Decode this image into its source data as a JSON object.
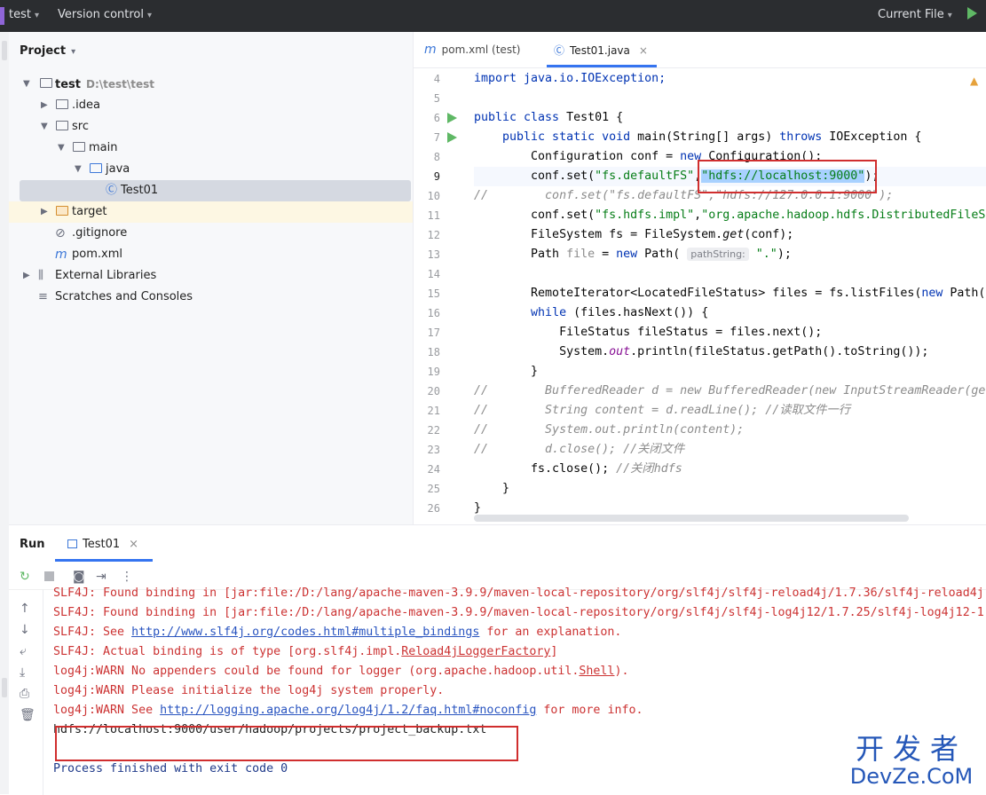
{
  "titlebar": {
    "project": "test",
    "vcs": "Version control",
    "run_config": "Current File"
  },
  "project_panel": {
    "title": "Project",
    "tree": [
      {
        "label": "test",
        "path": "D:\\test\\test"
      },
      {
        "label": ".idea"
      },
      {
        "label": "src"
      },
      {
        "label": "main"
      },
      {
        "label": "java"
      },
      {
        "label": "Test01"
      },
      {
        "label": "target"
      },
      {
        "label": ".gitignore"
      },
      {
        "label": "pom.xml"
      },
      {
        "label": "External Libraries"
      },
      {
        "label": "Scratches and Consoles"
      }
    ]
  },
  "editor": {
    "tabs": [
      {
        "label": "pom.xml (test)"
      },
      {
        "label": "Test01.java"
      }
    ],
    "line_numbers": [
      "4",
      "5",
      "6",
      "7",
      "8",
      "9",
      "10",
      "11",
      "12",
      "13",
      "14",
      "15",
      "16",
      "17",
      "18",
      "19",
      "20",
      "21",
      "22",
      "23",
      "24",
      "25",
      "26"
    ],
    "code": {
      "l4": "import java.io.IOException;",
      "l6a": "public class ",
      "l6b": "Test01 {",
      "l7a": "    public static void ",
      "l7b": "main(String[] args) ",
      "l7c": "throws ",
      "l7d": "IOException {",
      "l8a": "        Configuration conf = ",
      "l8b": "new ",
      "l8c": "Configuration();",
      "l9a": "        conf.set(",
      "l9b": "\"fs.defaultFS\"",
      "l9c": ",",
      "l9d": "\"hdfs://localhost:9000\"",
      "l9e": ");",
      "l10": "//        conf.set(\"fs.defaultFS\",\"hdfs://127.0.0.1:9000\");",
      "l11a": "        conf.set(",
      "l11b": "\"fs.hdfs.impl\"",
      "l11c": ",",
      "l11d": "\"org.apache.hadoop.hdfs.DistributedFileS",
      "l12a": "        FileSystem fs = FileSystem.",
      "l12b": "get",
      "l12c": "(conf);",
      "l13a": "        Path ",
      "l13b": "file",
      "l13c": " = ",
      "l13d": "new ",
      "l13e": "Path( ",
      "l13hint": "pathString:",
      "l13f": " ",
      "l13g": "\".\"",
      "l13h": ");",
      "l15a": "        RemoteIterator<LocatedFileStatus> files = fs.listFiles(",
      "l15b": "new ",
      "l15c": "Path(",
      "l16a": "        ",
      "l16b": "while ",
      "l16c": "(files.hasNext()) {",
      "l17": "            FileStatus fileStatus = files.next();",
      "l18a": "            System.",
      "l18b": "out",
      "l18c": ".println(fileStatus.getPath().toString());",
      "l19": "        }",
      "l20": "//        BufferedReader d = new BufferedReader(new InputStreamReader(ge",
      "l21": "//        String content = d.readLine(); //读取文件一行",
      "l22": "//        System.out.println(content);",
      "l23": "//        d.close(); //关闭文件",
      "l24a": "        fs.close(); ",
      "l24b": "//关闭hdfs",
      "l25": "    }",
      "l26": "}"
    }
  },
  "run_panel": {
    "title": "Run",
    "tab": "Test01",
    "output": {
      "o1": "SLF4J: Found binding in [jar:file:/D:/lang/apache-maven-3.9.9/maven-local-repository/org/slf4j/slf4j-reload4j/1.7.36/slf4j-reload4j-",
      "o2": "SLF4J: Found binding in [jar:file:/D:/lang/apache-maven-3.9.9/maven-local-repository/org/slf4j/slf4j-log4j12/1.7.25/slf4j-log4j12-1",
      "o3a": "SLF4J: See ",
      "o3b": "http://www.slf4j.org/codes.html#multiple_bindings",
      "o3c": " for an explanation.",
      "o4a": "SLF4J: Actual binding is of type [org.slf4j.impl.",
      "o4b": "Reload4jLoggerFactory",
      "o4c": "]",
      "o5a": "log4j:WARN No appenders could be found for logger (org.apache.hadoop.util.",
      "o5b": "Shell",
      "o5c": ").",
      "o6": "log4j:WARN Please initialize the log4j system properly.",
      "o7a": "log4j:WARN See ",
      "o7b": "http://logging.apache.org/log4j/1.2/faq.html#noconfig",
      "o7c": " for more info.",
      "o8": "hdfs://localhost:9000/user/hadoop/projects/project_backup.txt",
      "o10": "Process finished with exit code 0"
    }
  },
  "watermark": {
    "cn": "开发者",
    "en": "DevZe.CoM"
  }
}
